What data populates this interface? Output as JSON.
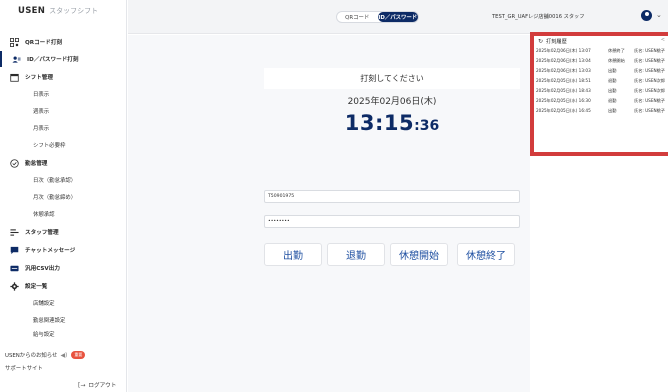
{
  "brand": {
    "name": "USEN",
    "sub": "スタッフシフト"
  },
  "sidebar": {
    "items": [
      {
        "label": "QRコード打刻",
        "kind": "top"
      },
      {
        "label": "ID／パスワード打刻",
        "kind": "top"
      },
      {
        "label": "シフト管理",
        "kind": "top"
      },
      {
        "label": "日表示",
        "kind": "sub"
      },
      {
        "label": "週表示",
        "kind": "sub"
      },
      {
        "label": "月表示",
        "kind": "sub"
      },
      {
        "label": "シフト必要枠",
        "kind": "sub"
      },
      {
        "label": "勤怠管理",
        "kind": "top"
      },
      {
        "label": "日次（勤怠承認）",
        "kind": "sub"
      },
      {
        "label": "月次（勤怠締め）",
        "kind": "sub"
      },
      {
        "label": "休憩承認",
        "kind": "sub"
      },
      {
        "label": "スタッフ管理",
        "kind": "top"
      },
      {
        "label": "チャットメッセージ",
        "kind": "top"
      },
      {
        "label": "汎用CSV出力",
        "kind": "top"
      },
      {
        "label": "設定一覧",
        "kind": "top"
      },
      {
        "label": "店舗設定",
        "kind": "sub"
      },
      {
        "label": "勤怠関連設定",
        "kind": "sub"
      },
      {
        "label": "給与設定",
        "kind": "sub"
      }
    ],
    "notice": {
      "label": "USENからのお知らせ",
      "badge": "重要"
    },
    "support": "サポートサイト",
    "logout": "ログアウト"
  },
  "header": {
    "tabs": [
      "QRコード",
      "ID／パスワード"
    ],
    "active_tab": "ID／パスワード",
    "user": "TEST_GR_UAFレジ店舗0016 スタッフ"
  },
  "main": {
    "prompt": "打刻してください",
    "date": "2025年02月06日(木)",
    "time_hm": "13:15",
    "time_sec": ":36",
    "id_value": "T50901975",
    "password_value": "••••••••",
    "buttons": [
      "出勤",
      "退勤",
      "休憩開始",
      "休憩終了"
    ]
  },
  "history": {
    "title": "打刻履歴",
    "rows": [
      {
        "datetime": "2025年02月06日(木) 13:07",
        "kind": "休憩終了",
        "name": "氏名: USEN桃子"
      },
      {
        "datetime": "2025年02月06日(木) 13:04",
        "kind": "休憩開始",
        "name": "氏名: USEN桃子"
      },
      {
        "datetime": "2025年02月06日(木) 13:03",
        "kind": "出勤",
        "name": "氏名: USEN桃子"
      },
      {
        "datetime": "2025年02月05日(水) 18:51",
        "kind": "退勤",
        "name": "氏名: USEN次郎"
      },
      {
        "datetime": "2025年02月05日(水) 18:43",
        "kind": "出勤",
        "name": "氏名: USEN次郎"
      },
      {
        "datetime": "2025年02月05日(水) 16:30",
        "kind": "退勤",
        "name": "氏名: USEN桃子"
      },
      {
        "datetime": "2025年02月05日(水) 16:45",
        "kind": "出勤",
        "name": "氏名: USEN桃子"
      }
    ]
  }
}
